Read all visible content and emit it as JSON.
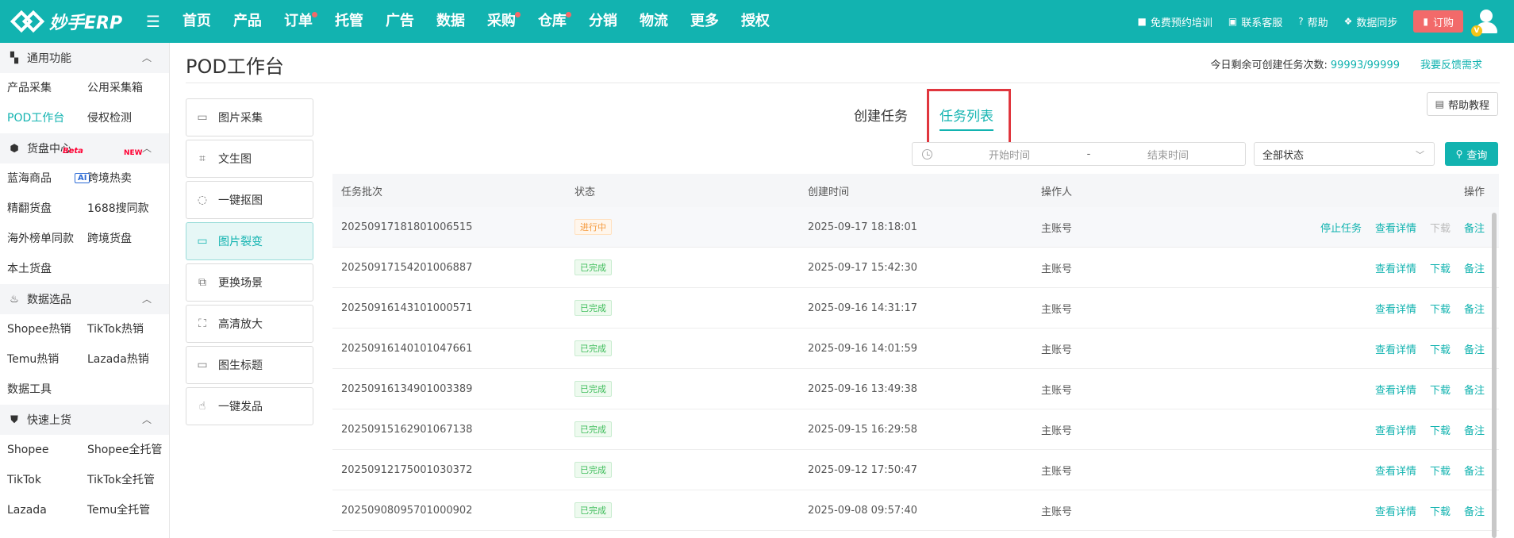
{
  "brand": {
    "logo_text": "妙手ERP"
  },
  "nav": [
    {
      "label": "首页",
      "dot": false
    },
    {
      "label": "产品",
      "dot": false
    },
    {
      "label": "订单",
      "dot": true
    },
    {
      "label": "托管",
      "dot": false
    },
    {
      "label": "广告",
      "dot": false
    },
    {
      "label": "数据",
      "dot": false
    },
    {
      "label": "采购",
      "dot": true
    },
    {
      "label": "仓库",
      "dot": true
    },
    {
      "label": "分销",
      "dot": false
    },
    {
      "label": "物流",
      "dot": false
    },
    {
      "label": "更多",
      "dot": false
    },
    {
      "label": "授权",
      "dot": false
    }
  ],
  "top_right": {
    "training": "免费预约培训",
    "service": "联系客服",
    "help": "帮助",
    "sync": "数据同步",
    "order": "订购",
    "vip_badge": "V"
  },
  "sidebar": {
    "sections": [
      {
        "title": "通用功能",
        "icon": "grid-icon",
        "items": [
          "产品采集",
          "公用采集箱",
          "POD工作台",
          "侵权检测"
        ]
      },
      {
        "title": "货盘中心",
        "icon": "cube-icon",
        "items": [
          "蓝海商品",
          "跨境热卖",
          "精翻货盘",
          "1688搜同款",
          "海外榜单同款",
          "跨境货盘",
          "本土货盘"
        ]
      },
      {
        "title": "数据选品",
        "icon": "fire-icon",
        "items": [
          "Shopee热销",
          "TikTok热销",
          "Temu热销",
          "Lazada热销",
          "数据工具"
        ]
      },
      {
        "title": "快速上货",
        "icon": "bag-icon",
        "items": [
          "Shopee",
          "Shopee全托管",
          "TikTok",
          "TikTok全托管",
          "Lazada",
          "Temu全托管"
        ]
      }
    ],
    "badges": {
      "beta": "Beta",
      "new": "NEW",
      "ai": "AI"
    }
  },
  "page": {
    "title": "POD工作台",
    "quota_label": "今日剩余可创建任务次数:",
    "quota_value": "99993/99999",
    "feedback": "我要反馈需求"
  },
  "tools": [
    {
      "label": "图片采集",
      "icon": "image-icon"
    },
    {
      "label": "文生图",
      "icon": "text-to-image-icon"
    },
    {
      "label": "一键抠图",
      "icon": "cutout-icon"
    },
    {
      "label": "图片裂变",
      "icon": "image-split-icon",
      "active": true
    },
    {
      "label": "更换场景",
      "icon": "scene-icon"
    },
    {
      "label": "高清放大",
      "icon": "upscale-icon"
    },
    {
      "label": "图生标题",
      "icon": "image-title-icon"
    },
    {
      "label": "一键发品",
      "icon": "publish-icon"
    }
  ],
  "tabs": {
    "create": "创建任务",
    "list": "任务列表"
  },
  "help_tutorial": "帮助教程",
  "filters": {
    "start_placeholder": "开始时间",
    "separator": "-",
    "end_placeholder": "结束时间",
    "status_value": "全部状态",
    "query": "查询"
  },
  "table": {
    "headers": {
      "batch": "任务批次",
      "status": "状态",
      "created": "创建时间",
      "operator": "操作人",
      "actions": "操作"
    },
    "action_labels": {
      "stop": "停止任务",
      "detail": "查看详情",
      "download": "下载",
      "note": "备注"
    },
    "rows": [
      {
        "batch": "20250917181801006515",
        "status": "进行中",
        "state": "running",
        "created": "2025-09-17 18:18:01",
        "operator": "主账号"
      },
      {
        "batch": "20250917154201006887",
        "status": "已完成",
        "state": "done",
        "created": "2025-09-17 15:42:30",
        "operator": "主账号"
      },
      {
        "batch": "20250916143101000571",
        "status": "已完成",
        "state": "done",
        "created": "2025-09-16 14:31:17",
        "operator": "主账号"
      },
      {
        "batch": "20250916140101047661",
        "status": "已完成",
        "state": "done",
        "created": "2025-09-16 14:01:59",
        "operator": "主账号"
      },
      {
        "batch": "20250916134901003389",
        "status": "已完成",
        "state": "done",
        "created": "2025-09-16 13:49:38",
        "operator": "主账号"
      },
      {
        "batch": "20250915162901067138",
        "status": "已完成",
        "state": "done",
        "created": "2025-09-15 16:29:58",
        "operator": "主账号"
      },
      {
        "batch": "20250912175001030372",
        "status": "已完成",
        "state": "done",
        "created": "2025-09-12 17:50:47",
        "operator": "主账号"
      },
      {
        "batch": "20250908095701000902",
        "status": "已完成",
        "state": "done",
        "created": "2025-09-08 09:57:40",
        "operator": "主账号"
      }
    ]
  },
  "colors": {
    "brand": "#12b3b0",
    "order_button": "#f26a6a",
    "highlight": "#e0363e",
    "running": "#f59a3d",
    "done": "#3fbd5b"
  }
}
